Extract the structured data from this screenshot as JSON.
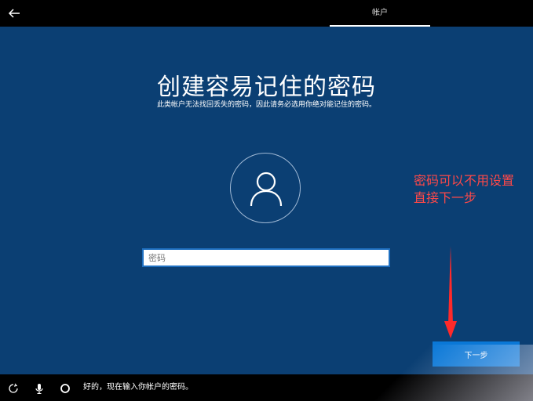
{
  "header": {
    "tab_label": "帐户"
  },
  "main": {
    "title": "创建容易记住的密码",
    "subtitle": "此类帐户无法找回丢失的密码，因此请务必选用你绝对能记住的密码。",
    "password_field": {
      "placeholder": "密码",
      "value": ""
    },
    "next_button_label": "下一步"
  },
  "annotation": {
    "line1": "密码可以不用设置",
    "line2": "直接下一步",
    "color": "#ff4848"
  },
  "bottombar": {
    "cortana_text": "好的，现在输入你帐户的密码。"
  },
  "colors": {
    "background": "#0b3f73",
    "accent": "#0a78d7"
  }
}
